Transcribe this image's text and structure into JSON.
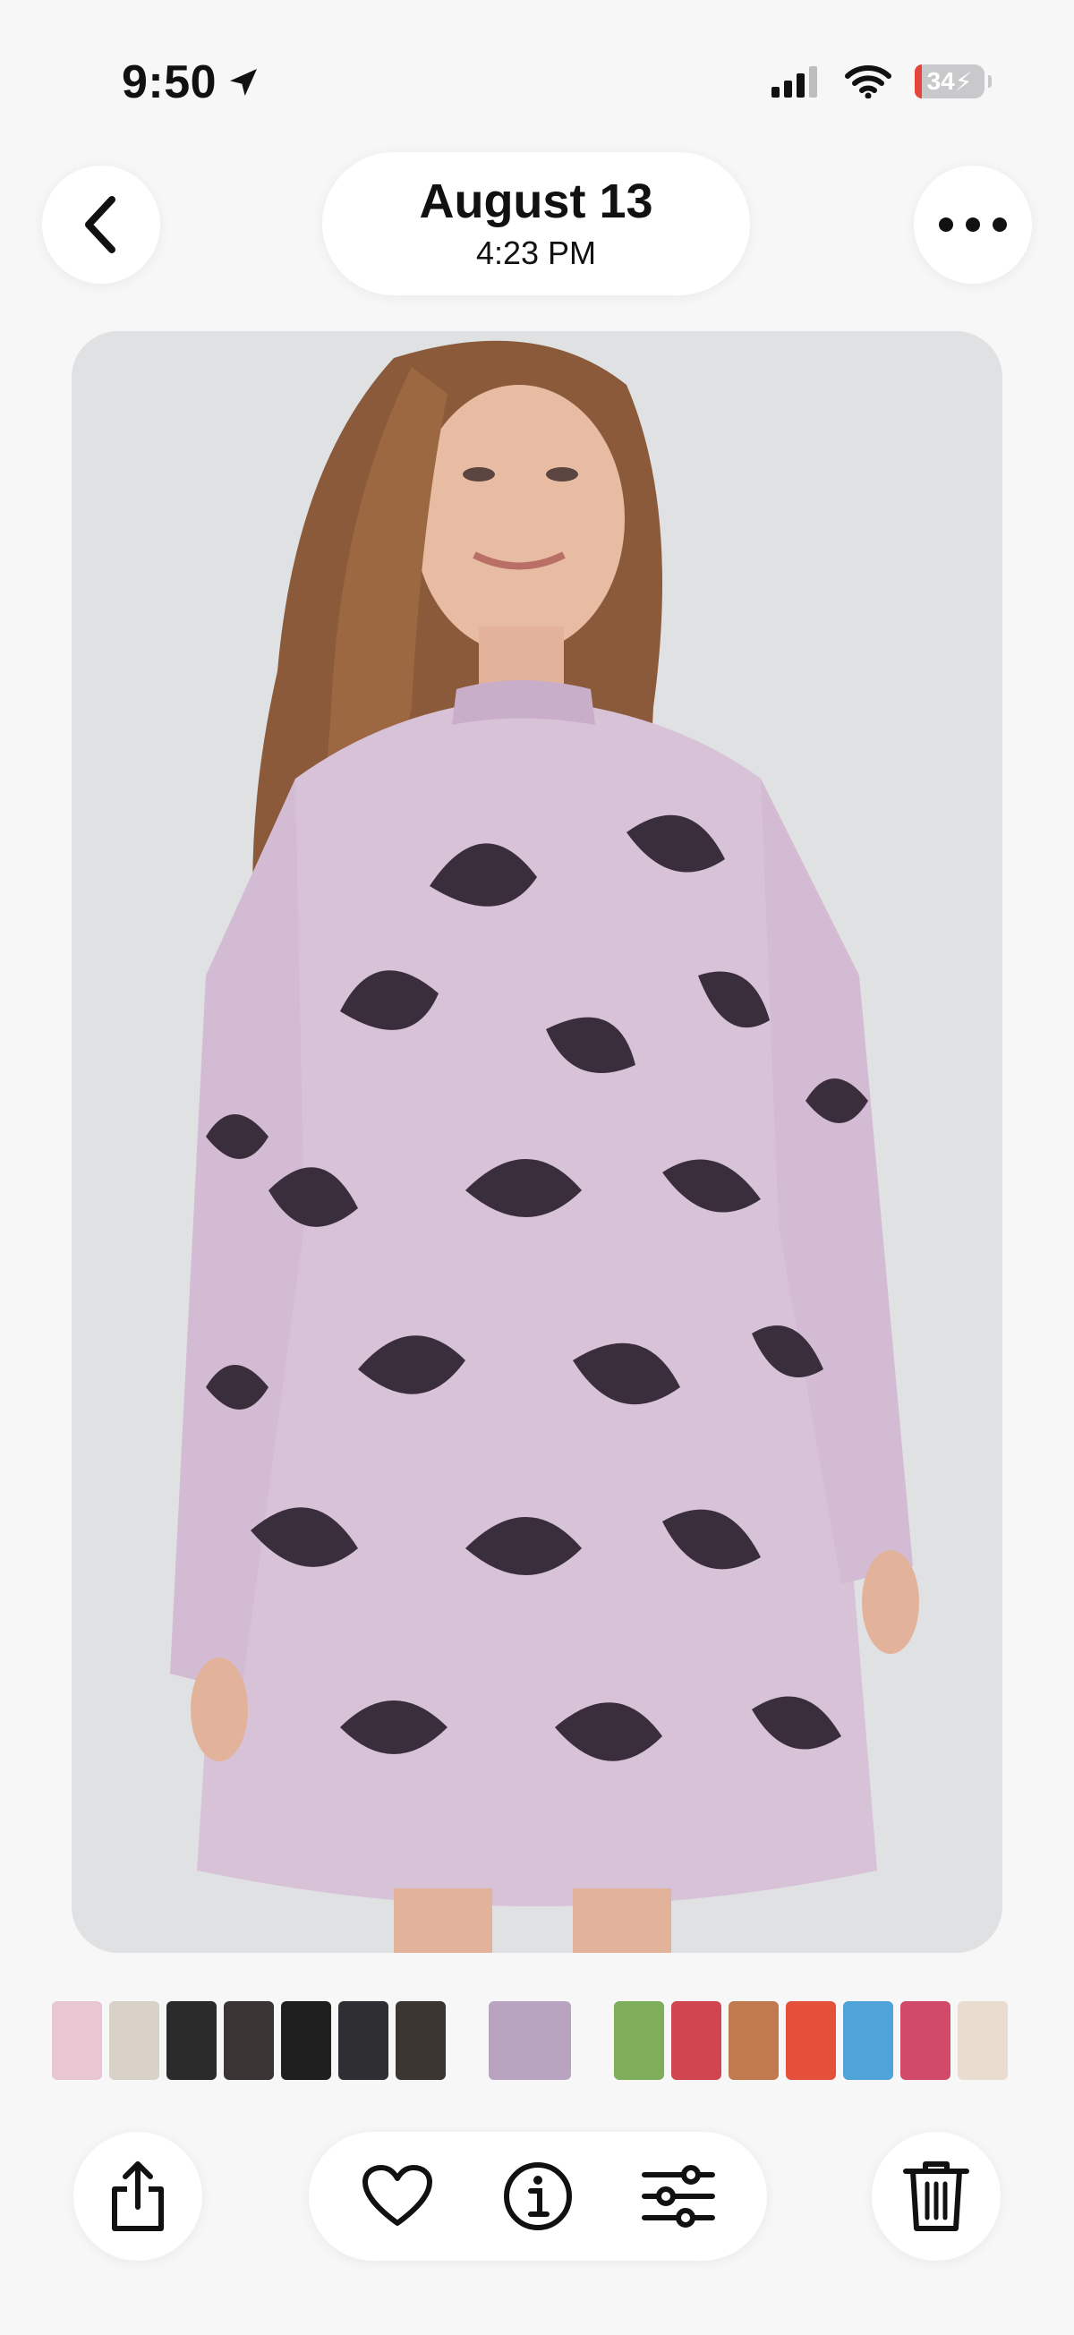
{
  "status_bar": {
    "time": "9:50",
    "battery": "34"
  },
  "header": {
    "date": "August 13",
    "time": "4:23 PM"
  },
  "icons": {
    "back": "chevron-left-icon",
    "more": "ellipsis-icon",
    "share": "share-icon",
    "favorite": "heart-icon",
    "info": "info-icon",
    "adjust": "sliders-icon",
    "delete": "trash-icon"
  },
  "thumbnails": [
    {
      "color": "#e9c7d2"
    },
    {
      "color": "#d9d2c8"
    },
    {
      "color": "#2b2b2b"
    },
    {
      "color": "#3a3534"
    },
    {
      "color": "#1f1f1f"
    },
    {
      "color": "#2f2f33"
    },
    {
      "color": "#3c3632"
    },
    {
      "color": "#b8a3c0",
      "active": true
    },
    {
      "color": "#7fae5a"
    },
    {
      "color": "#d0454f"
    },
    {
      "color": "#c07a4e"
    },
    {
      "color": "#e4503a"
    },
    {
      "color": "#4fa3d8"
    },
    {
      "color": "#d24a6a"
    },
    {
      "color": "#e9ddd0"
    }
  ],
  "colors": {
    "background": "#f7f7f8",
    "photo_bg": "#dfe1e3",
    "dress": "#d8c2d8",
    "print": "#3a2e3c"
  }
}
